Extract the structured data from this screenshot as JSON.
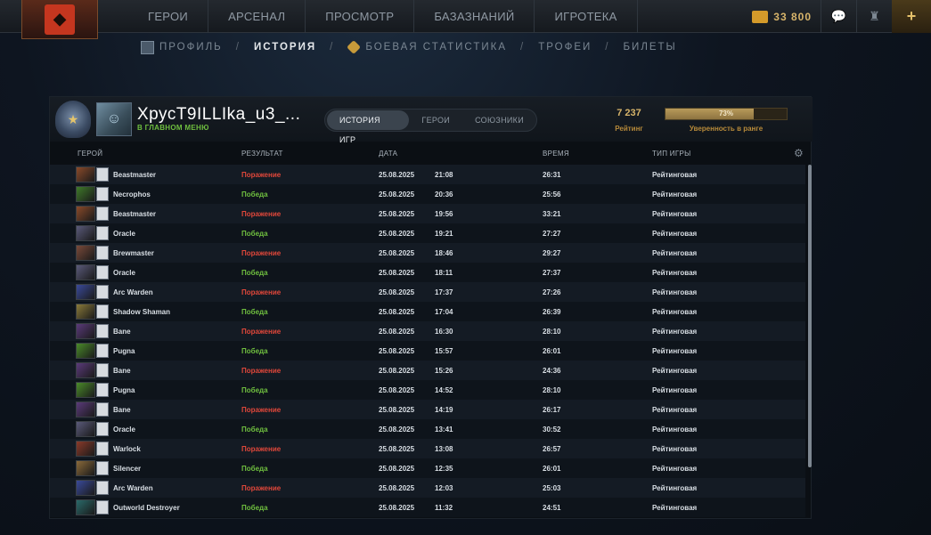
{
  "nav": {
    "items": [
      "ГЕРОИ",
      "АРСЕНАЛ",
      "ПРОСМОТР",
      "БАЗАЗНАНИЙ",
      "ИГРОТЕКА"
    ],
    "shards": "33 800"
  },
  "subnav": {
    "profile": "ПРОФИЛЬ",
    "history": "ИСТОРИЯ",
    "stats": "БОЕВАЯ СТАТИСТИКА",
    "trophies": "ТРОФЕИ",
    "tickets": "БИЛЕТЫ",
    "sep": "/"
  },
  "player": {
    "name": "ХрусТ9ILLIka_u3_...",
    "status": "В ГЛАВНОМ МЕНЮ"
  },
  "tabs": {
    "history": "ИСТОРИЯ ИГР",
    "heroes": "ГЕРОИ",
    "allies": "СОЮЗНИКИ"
  },
  "rating": {
    "value": "7 237",
    "label": "Рейтинг"
  },
  "confidence": {
    "percent": "73%",
    "fraction": 0.73,
    "label": "Уверенность в ранге"
  },
  "columns": {
    "hero": "ГЕРОЙ",
    "result": "РЕЗУЛЬТАТ",
    "date": "ДАТА",
    "duration": "ВРЕМЯ",
    "type": "ТИП ИГРЫ"
  },
  "matches": [
    {
      "hero": "Beastmaster",
      "result": "Поражение",
      "win": false,
      "date": "25.08.2025",
      "time": "21:08",
      "duration": "26:31",
      "type": "Рейтинговая",
      "color": "#8a4a2a"
    },
    {
      "hero": "Necrophos",
      "result": "Победа",
      "win": true,
      "date": "25.08.2025",
      "time": "20:36",
      "duration": "25:56",
      "type": "Рейтинговая",
      "color": "#3f7a2a"
    },
    {
      "hero": "Beastmaster",
      "result": "Поражение",
      "win": false,
      "date": "25.08.2025",
      "time": "19:56",
      "duration": "33:21",
      "type": "Рейтинговая",
      "color": "#8a4a2a"
    },
    {
      "hero": "Oracle",
      "result": "Победа",
      "win": true,
      "date": "25.08.2025",
      "time": "19:21",
      "duration": "27:27",
      "type": "Рейтинговая",
      "color": "#5a5a7a"
    },
    {
      "hero": "Brewmaster",
      "result": "Поражение",
      "win": false,
      "date": "25.08.2025",
      "time": "18:46",
      "duration": "29:27",
      "type": "Рейтинговая",
      "color": "#7a4a3a"
    },
    {
      "hero": "Oracle",
      "result": "Победа",
      "win": true,
      "date": "25.08.2025",
      "time": "18:11",
      "duration": "27:37",
      "type": "Рейтинговая",
      "color": "#5a5a7a"
    },
    {
      "hero": "Arc Warden",
      "result": "Поражение",
      "win": false,
      "date": "25.08.2025",
      "time": "17:37",
      "duration": "27:26",
      "type": "Рейтинговая",
      "color": "#3a4a9a"
    },
    {
      "hero": "Shadow Shaman",
      "result": "Победа",
      "win": true,
      "date": "25.08.2025",
      "time": "17:04",
      "duration": "26:39",
      "type": "Рейтинговая",
      "color": "#8a7a3a"
    },
    {
      "hero": "Bane",
      "result": "Поражение",
      "win": false,
      "date": "25.08.2025",
      "time": "16:30",
      "duration": "28:10",
      "type": "Рейтинговая",
      "color": "#5a3a7a"
    },
    {
      "hero": "Pugna",
      "result": "Победа",
      "win": true,
      "date": "25.08.2025",
      "time": "15:57",
      "duration": "26:01",
      "type": "Рейтинговая",
      "color": "#4a8a2a"
    },
    {
      "hero": "Bane",
      "result": "Поражение",
      "win": false,
      "date": "25.08.2025",
      "time": "15:26",
      "duration": "24:36",
      "type": "Рейтинговая",
      "color": "#5a3a7a"
    },
    {
      "hero": "Pugna",
      "result": "Победа",
      "win": true,
      "date": "25.08.2025",
      "time": "14:52",
      "duration": "28:10",
      "type": "Рейтинговая",
      "color": "#4a8a2a"
    },
    {
      "hero": "Bane",
      "result": "Поражение",
      "win": false,
      "date": "25.08.2025",
      "time": "14:19",
      "duration": "26:17",
      "type": "Рейтинговая",
      "color": "#5a3a7a"
    },
    {
      "hero": "Oracle",
      "result": "Победа",
      "win": true,
      "date": "25.08.2025",
      "time": "13:41",
      "duration": "30:52",
      "type": "Рейтинговая",
      "color": "#5a5a7a"
    },
    {
      "hero": "Warlock",
      "result": "Поражение",
      "win": false,
      "date": "25.08.2025",
      "time": "13:08",
      "duration": "26:57",
      "type": "Рейтинговая",
      "color": "#8a3a2a"
    },
    {
      "hero": "Silencer",
      "result": "Победа",
      "win": true,
      "date": "25.08.2025",
      "time": "12:35",
      "duration": "26:01",
      "type": "Рейтинговая",
      "color": "#8a6a3a"
    },
    {
      "hero": "Arc Warden",
      "result": "Поражение",
      "win": false,
      "date": "25.08.2025",
      "time": "12:03",
      "duration": "25:03",
      "type": "Рейтинговая",
      "color": "#3a4a9a"
    },
    {
      "hero": "Outworld Destroyer",
      "result": "Победа",
      "win": true,
      "date": "25.08.2025",
      "time": "11:32",
      "duration": "24:51",
      "type": "Рейтинговая",
      "color": "#2a6a6a"
    }
  ],
  "colors": {
    "win": "#6fbf3f",
    "loss": "#e0473a",
    "gold": "#d7b46a"
  }
}
